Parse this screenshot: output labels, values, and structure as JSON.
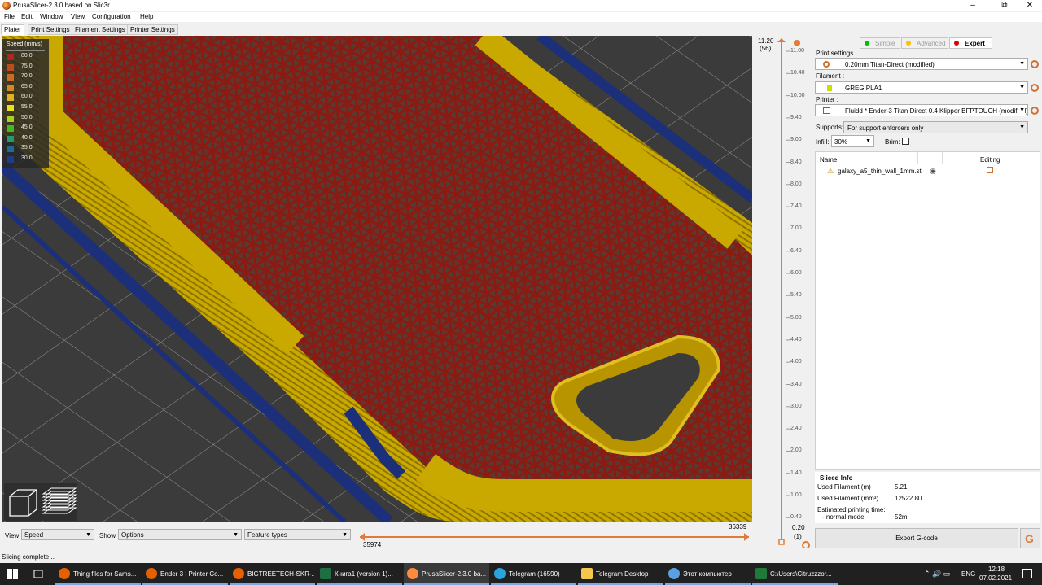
{
  "window": {
    "title": "PrusaSlicer-2.3.0 based on Slic3r"
  },
  "menu": [
    "File",
    "Edit",
    "Window",
    "View",
    "Configuration",
    "Help"
  ],
  "tabs": [
    "Plater",
    "Print Settings",
    "Filament Settings",
    "Printer Settings"
  ],
  "legend": {
    "title": "Speed (mm/s)",
    "items": [
      {
        "value": "80.0",
        "color": "#b3261e"
      },
      {
        "value": "75.0",
        "color": "#c04a1c"
      },
      {
        "value": "70.0",
        "color": "#cc6c1e"
      },
      {
        "value": "65.0",
        "color": "#d28a20"
      },
      {
        "value": "60.0",
        "color": "#e1b21a"
      },
      {
        "value": "55.0",
        "color": "#e9e21b"
      },
      {
        "value": "50.0",
        "color": "#a8d21b"
      },
      {
        "value": "45.0",
        "color": "#3dbd25"
      },
      {
        "value": "40.0",
        "color": "#1f9e6c"
      },
      {
        "value": "35.0",
        "color": "#1c6d92"
      },
      {
        "value": "30.0",
        "color": "#1c3c8c"
      }
    ]
  },
  "layer_slider": {
    "top_height": "11.20",
    "top_layer": "(56)",
    "bottom_height": "0.20",
    "bottom_layer": "(1)",
    "ticks": [
      "11.00",
      "10.40",
      "10.00",
      "9.40",
      "9.00",
      "8.40",
      "8.00",
      "7.40",
      "7.00",
      "6.40",
      "6.00",
      "5.40",
      "5.00",
      "4.40",
      "4.00",
      "3.40",
      "3.00",
      "2.40",
      "2.00",
      "1.40",
      "1.00",
      "0.40"
    ]
  },
  "bottom": {
    "view_label": "View",
    "view_value": "Speed",
    "show_label": "Show",
    "show_value": "Options",
    "feature_value": "Feature types",
    "hslider_start": "35974",
    "hslider_end": "36339"
  },
  "panel": {
    "modes": [
      "Simple",
      "Advanced",
      "Expert"
    ],
    "mode_colors": [
      "#00c000",
      "#ffc000",
      "#e00000"
    ],
    "print_label": "Print settings :",
    "print_value": "0.20mm Titan-Direct (modified)",
    "filament_label": "Filament :",
    "filament_value": "GREG PLA1",
    "filament_color": "#c8e000",
    "printer_label": "Printer :",
    "printer_value": "Fluidd * Ender-3 Titan Direct 0.4 Klipper BFPTOUCH (modified)",
    "supports_label": "Supports:",
    "supports_value": "For support enforcers only",
    "infill_label": "Infill:",
    "infill_value": "30%",
    "brim_label": "Brim:",
    "col_name": "Name",
    "col_editing": "Editing",
    "object_name": "galaxy_a5_thin_wall_1mm.stl"
  },
  "sliced_info": {
    "title": "Sliced Info",
    "rows": [
      {
        "label": "Used Filament (m)",
        "value": "5.21"
      },
      {
        "label": "Used Filament (mm³)",
        "value": "12522.80"
      }
    ],
    "time_label": "Estimated printing time:",
    "mode_label": "- normal mode",
    "mode_value": "52m"
  },
  "export_label": "Export G-code",
  "status": "Slicing complete...",
  "taskbar": {
    "apps": [
      {
        "label": "Thing files for Sams...",
        "icon": "firefox-icon"
      },
      {
        "label": "Ender 3 | Printer Co...",
        "icon": "firefox-icon"
      },
      {
        "label": "BIGTREETECH-SKR-...",
        "icon": "firefox-icon"
      },
      {
        "label": "Книга1 (version 1)...",
        "icon": "excel-icon"
      },
      {
        "label": "PrusaSlicer-2.3.0 ba...",
        "icon": "prusaslicer-icon"
      },
      {
        "label": "Telegram (16590)",
        "icon": "telegram-icon"
      },
      {
        "label": "Telegram Desktop",
        "icon": "folder-icon"
      },
      {
        "label": "Этот компьютер",
        "icon": "computer-icon"
      },
      {
        "label": "C:\\Users\\Citruzzzor...",
        "icon": "cmd-icon"
      }
    ],
    "lang": "ENG",
    "time": "12:18",
    "date": "07.02.2021"
  }
}
